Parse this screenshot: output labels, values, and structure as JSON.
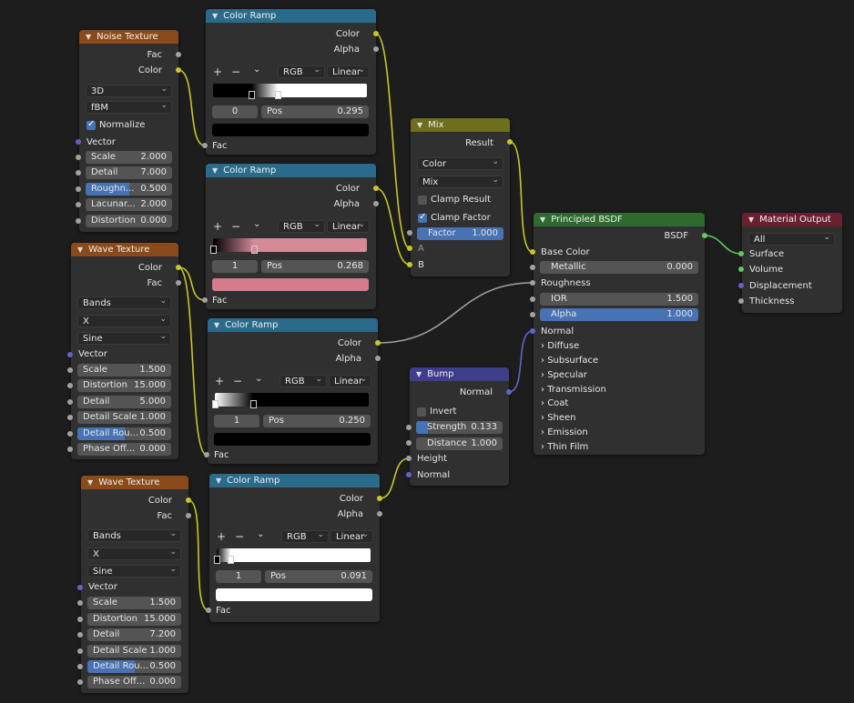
{
  "colors": {
    "texture_header": "#8a4a1a",
    "converter_header": "#2a6a8a",
    "mix_header": "#6e6e1e",
    "vector_header": "#3e3e8a",
    "shader_header": "#2e6a2e",
    "output_header": "#6a2030",
    "wire_color": "#c7c729",
    "wire_shader": "#63c763",
    "wire_float": "#a1a1a1",
    "wire_vector": "#6363c7",
    "highlight": "#4772b3"
  },
  "icons": {
    "collapse": "chevron-down-icon",
    "add": "plus-icon",
    "remove": "minus-icon",
    "dropdown": "chevron-down-icon",
    "expand": "chevron-right-icon",
    "check": "checkmark-icon"
  },
  "noise": {
    "title": "Noise Texture",
    "out_fac": "Fac",
    "out_color": "Color",
    "dim": "3D",
    "type": "fBM",
    "normalize": "Normalize",
    "normalize_checked": true,
    "in_vector": "Vector",
    "scale_label": "Scale",
    "scale_value": "2.000",
    "detail_label": "Detail",
    "detail_value": "7.000",
    "rough_label": "Roughn...",
    "rough_value": "0.500",
    "rough_fraction": 0.5,
    "lac_label": "Lacunar...",
    "lac_value": "2.000",
    "dist_label": "Distortion",
    "dist_value": "0.000"
  },
  "wave1": {
    "title": "Wave Texture",
    "out_color": "Color",
    "out_fac": "Fac",
    "type": "Bands",
    "dir": "X",
    "profile": "Sine",
    "in_vector": "Vector",
    "scale_label": "Scale",
    "scale_value": "1.500",
    "dist_label": "Distortion",
    "dist_value": "15.000",
    "detail_label": "Detail",
    "detail_value": "5.000",
    "dscale_label": "Detail Scale",
    "dscale_value": "1.000",
    "drough_label": "Detail Rou...",
    "drough_value": "0.500",
    "drough_fraction": 0.5,
    "phase_label": "Phase Off...",
    "phase_value": "0.000"
  },
  "wave2": {
    "title": "Wave Texture",
    "out_color": "Color",
    "out_fac": "Fac",
    "type": "Bands",
    "dir": "X",
    "profile": "Sine",
    "in_vector": "Vector",
    "scale_label": "Scale",
    "scale_value": "1.500",
    "dist_label": "Distortion",
    "dist_value": "15.000",
    "detail_label": "Detail",
    "detail_value": "7.200",
    "dscale_label": "Detail Scale",
    "dscale_value": "1.000",
    "drough_label": "Detail Rou...",
    "drough_value": "0.500",
    "drough_fraction": 0.5,
    "phase_label": "Phase Off...",
    "phase_value": "0.000"
  },
  "ramp1": {
    "title": "Color Ramp",
    "out_color": "Color",
    "out_alpha": "Alpha",
    "add": "+",
    "remove": "−",
    "mode": "RGB",
    "interp": "Linear",
    "index": "0",
    "pos_label": "Pos",
    "pos_value": "0.295",
    "in_fac": "Fac",
    "color_a": "#000000",
    "color_b": "#ffffff",
    "stop_a": 0.25,
    "stop_b": 0.42,
    "swatch": "#000000"
  },
  "ramp2": {
    "title": "Color Ramp",
    "out_color": "Color",
    "out_alpha": "Alpha",
    "add": "+",
    "remove": "−",
    "mode": "RGB",
    "interp": "Linear",
    "index": "1",
    "pos_label": "Pos",
    "pos_value": "0.268",
    "in_fac": "Fac",
    "color_a": "#000000",
    "color_b": "#d68a98",
    "stop_a": 0.0,
    "stop_b": 0.268,
    "swatch": "#d67a8c"
  },
  "ramp3": {
    "title": "Color Ramp",
    "out_color": "Color",
    "out_alpha": "Alpha",
    "add": "+",
    "remove": "−",
    "mode": "RGB",
    "interp": "Linear",
    "index": "1",
    "pos_label": "Pos",
    "pos_value": "0.250",
    "in_fac": "Fac",
    "color_a": "#ffffff",
    "color_b": "#000000",
    "stop_a": 0.0,
    "stop_b": 0.25,
    "swatch": "#000000"
  },
  "ramp4": {
    "title": "Color Ramp",
    "out_color": "Color",
    "out_alpha": "Alpha",
    "add": "+",
    "remove": "−",
    "mode": "RGB",
    "interp": "Linear",
    "index": "1",
    "pos_label": "Pos",
    "pos_value": "0.091",
    "in_fac": "Fac",
    "color_a": "#000000",
    "color_b": "#ffffff",
    "stop_a": 0.0,
    "stop_b": 0.091,
    "swatch": "#ffffff"
  },
  "mix": {
    "title": "Mix",
    "out_result": "Result",
    "data_type": "Color",
    "blend": "Mix",
    "clamp_result": "Clamp Result",
    "clamp_result_checked": false,
    "clamp_factor": "Clamp Factor",
    "clamp_factor_checked": true,
    "factor_label": "Factor",
    "factor_value": "1.000",
    "in_a": "A",
    "in_b": "B"
  },
  "bump": {
    "title": "Bump",
    "out_normal": "Normal",
    "invert": "Invert",
    "invert_checked": false,
    "strength_label": "Strength",
    "strength_value": "0.133",
    "strength_fraction": 0.133,
    "distance_label": "Distance",
    "distance_value": "1.000",
    "in_height": "Height",
    "in_normal": "Normal"
  },
  "bsdf": {
    "title": "Principled BSDF",
    "out_bsdf": "BSDF",
    "base_color": "Base Color",
    "metallic_label": "Metallic",
    "metallic_value": "0.000",
    "roughness": "Roughness",
    "ior_label": "IOR",
    "ior_value": "1.500",
    "alpha_label": "Alpha",
    "alpha_value": "1.000",
    "normal": "Normal",
    "panels": [
      "Diffuse",
      "Subsurface",
      "Specular",
      "Transmission",
      "Coat",
      "Sheen",
      "Emission",
      "Thin Film"
    ]
  },
  "output": {
    "title": "Material Output",
    "target": "All",
    "surface": "Surface",
    "volume": "Volume",
    "displacement": "Displacement",
    "thickness": "Thickness"
  }
}
